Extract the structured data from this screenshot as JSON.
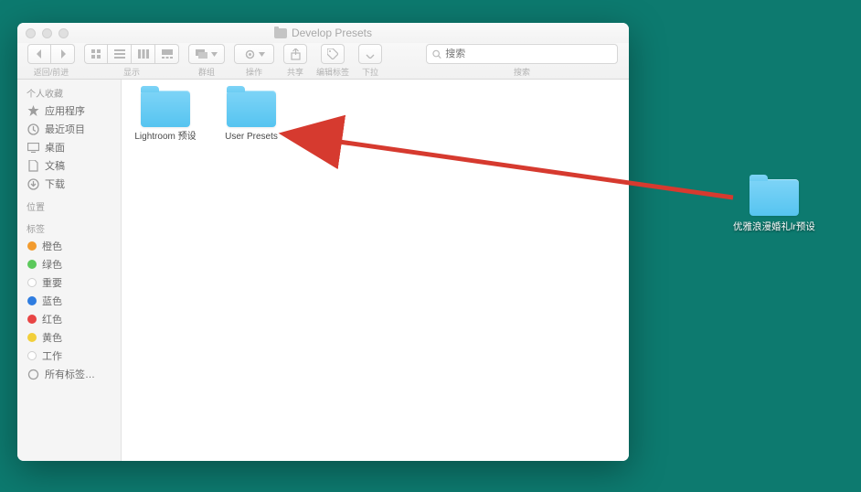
{
  "window": {
    "title": "Develop Presets"
  },
  "toolbar": {
    "nav_label": "返回/前进",
    "view_label": "显示",
    "group_label": "群组",
    "action_label": "操作",
    "share_label": "共享",
    "edit_tags_label": "编辑标签",
    "dropdown_label": "下拉",
    "search_placeholder": "搜索",
    "search_label": "搜索"
  },
  "sidebar": {
    "favorites_header": "个人收藏",
    "favorites": [
      {
        "icon": "apps",
        "label": "应用程序"
      },
      {
        "icon": "recent",
        "label": "最近项目"
      },
      {
        "icon": "desktop",
        "label": "桌面"
      },
      {
        "icon": "documents",
        "label": "文稿"
      },
      {
        "icon": "downloads",
        "label": "下载"
      }
    ],
    "locations_header": "位置",
    "tags_header": "标签",
    "tags": [
      {
        "color": "#f29b2e",
        "label": "橙色"
      },
      {
        "color": "#5cc95c",
        "label": "绿色"
      },
      {
        "color": "#dcdcdc",
        "label": "重要",
        "hollow": true
      },
      {
        "color": "#2f7de0",
        "label": "蓝色"
      },
      {
        "color": "#e84545",
        "label": "红色"
      },
      {
        "color": "#f2cf3a",
        "label": "黄色"
      },
      {
        "color": "#dcdcdc",
        "label": "工作",
        "hollow": true
      },
      {
        "color": "",
        "label": "所有标签…",
        "all": true
      }
    ]
  },
  "content": {
    "items": [
      {
        "label": "Lightroom 预设"
      },
      {
        "label": "User Presets"
      }
    ]
  },
  "desktop_item": {
    "label": "优雅浪漫婚礼lr预设"
  }
}
